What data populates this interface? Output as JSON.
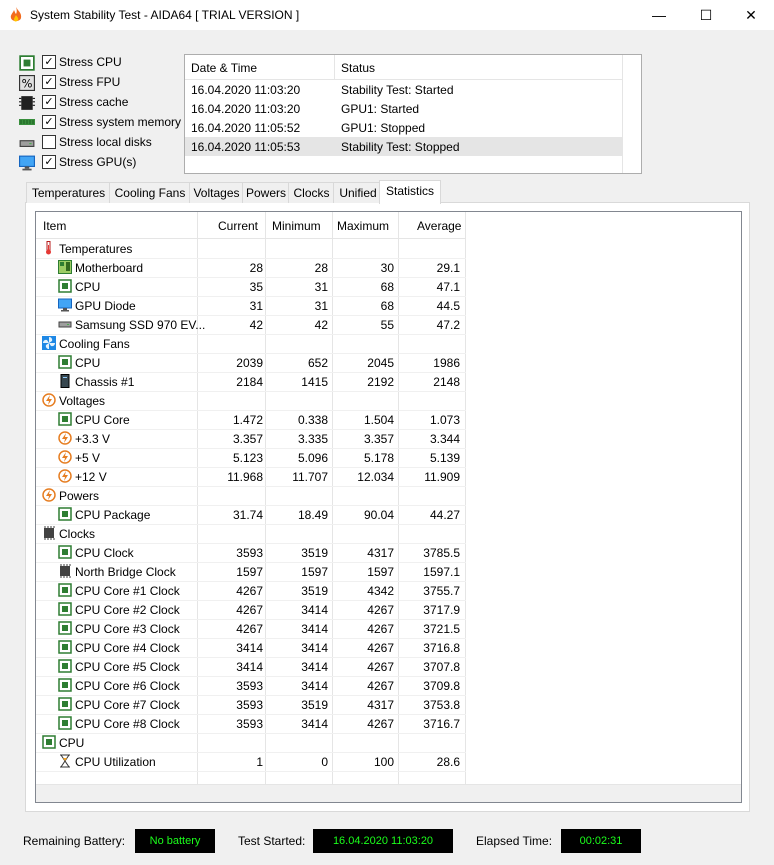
{
  "window": {
    "title": "System Stability Test - AIDA64  [ TRIAL VERSION ]",
    "min_glyph": "—",
    "max_glyph": "☐",
    "close_glyph": "✕"
  },
  "stress_options": [
    {
      "label": "Stress CPU",
      "checked": true,
      "icon": "cpu-chip-icon"
    },
    {
      "label": "Stress FPU",
      "checked": true,
      "icon": "fpu-icon"
    },
    {
      "label": "Stress cache",
      "checked": true,
      "icon": "cache-icon"
    },
    {
      "label": "Stress system memory",
      "checked": true,
      "icon": "memory-icon"
    },
    {
      "label": "Stress local disks",
      "checked": false,
      "icon": "disk-icon"
    },
    {
      "label": "Stress GPU(s)",
      "checked": true,
      "icon": "gpu-monitor-icon"
    }
  ],
  "log": {
    "col_datetime": "Date & Time",
    "col_status": "Status",
    "rows": [
      {
        "datetime": "16.04.2020 11:03:20",
        "status": "Stability Test: Started"
      },
      {
        "datetime": "16.04.2020 11:03:20",
        "status": "GPU1: Started"
      },
      {
        "datetime": "16.04.2020 11:05:52",
        "status": "GPU1: Stopped"
      },
      {
        "datetime": "16.04.2020 11:05:53",
        "status": "Stability Test: Stopped"
      }
    ]
  },
  "tabs": [
    "Temperatures",
    "Cooling Fans",
    "Voltages",
    "Powers",
    "Clocks",
    "Unified",
    "Statistics"
  ],
  "active_tab": "Statistics",
  "stats": {
    "col_item": "Item",
    "col_current": "Current",
    "col_minimum": "Minimum",
    "col_maximum": "Maximum",
    "col_average": "Average",
    "rows": [
      {
        "type": "group",
        "name": "Temperatures",
        "icon": "thermometer-icon"
      },
      {
        "type": "item",
        "name": "Motherboard",
        "icon": "motherboard-icon",
        "cur": "28",
        "min": "28",
        "max": "30",
        "avg": "29.1"
      },
      {
        "type": "item",
        "name": "CPU",
        "icon": "cpu-chip-icon",
        "cur": "35",
        "min": "31",
        "max": "68",
        "avg": "47.1"
      },
      {
        "type": "item",
        "name": "GPU Diode",
        "icon": "gpu-monitor-icon",
        "cur": "31",
        "min": "31",
        "max": "68",
        "avg": "44.5"
      },
      {
        "type": "item",
        "name": "Samsung SSD 970 EV...",
        "icon": "disk-icon",
        "cur": "42",
        "min": "42",
        "max": "55",
        "avg": "47.2"
      },
      {
        "type": "group",
        "name": "Cooling Fans",
        "icon": "fan-icon"
      },
      {
        "type": "item",
        "name": "CPU",
        "icon": "cpu-chip-icon",
        "cur": "2039",
        "min": "652",
        "max": "2045",
        "avg": "1986"
      },
      {
        "type": "item",
        "name": "Chassis #1",
        "icon": "chassis-icon",
        "cur": "2184",
        "min": "1415",
        "max": "2192",
        "avg": "2148"
      },
      {
        "type": "group",
        "name": "Voltages",
        "icon": "bolt-icon"
      },
      {
        "type": "item",
        "name": "CPU Core",
        "icon": "cpu-chip-icon",
        "cur": "1.472",
        "min": "0.338",
        "max": "1.504",
        "avg": "1.073"
      },
      {
        "type": "item",
        "name": "+3.3 V",
        "icon": "bolt-icon",
        "cur": "3.357",
        "min": "3.335",
        "max": "3.357",
        "avg": "3.344"
      },
      {
        "type": "item",
        "name": "+5 V",
        "icon": "bolt-icon",
        "cur": "5.123",
        "min": "5.096",
        "max": "5.178",
        "avg": "5.139"
      },
      {
        "type": "item",
        "name": "+12 V",
        "icon": "bolt-icon",
        "cur": "11.968",
        "min": "11.707",
        "max": "12.034",
        "avg": "11.909"
      },
      {
        "type": "group",
        "name": "Powers",
        "icon": "bolt-icon"
      },
      {
        "type": "item",
        "name": "CPU Package",
        "icon": "cpu-chip-icon",
        "cur": "31.74",
        "min": "18.49",
        "max": "90.04",
        "avg": "44.27"
      },
      {
        "type": "group",
        "name": "Clocks",
        "icon": "clock-chip-icon"
      },
      {
        "type": "item",
        "name": "CPU Clock",
        "icon": "cpu-chip-icon",
        "cur": "3593",
        "min": "3519",
        "max": "4317",
        "avg": "3785.5"
      },
      {
        "type": "item",
        "name": "North Bridge Clock",
        "icon": "clock-chip-icon",
        "cur": "1597",
        "min": "1597",
        "max": "1597",
        "avg": "1597.1"
      },
      {
        "type": "item",
        "name": "CPU Core #1 Clock",
        "icon": "cpu-chip-icon",
        "cur": "4267",
        "min": "3519",
        "max": "4342",
        "avg": "3755.7"
      },
      {
        "type": "item",
        "name": "CPU Core #2 Clock",
        "icon": "cpu-chip-icon",
        "cur": "4267",
        "min": "3414",
        "max": "4267",
        "avg": "3717.9"
      },
      {
        "type": "item",
        "name": "CPU Core #3 Clock",
        "icon": "cpu-chip-icon",
        "cur": "4267",
        "min": "3414",
        "max": "4267",
        "avg": "3721.5"
      },
      {
        "type": "item",
        "name": "CPU Core #4 Clock",
        "icon": "cpu-chip-icon",
        "cur": "3414",
        "min": "3414",
        "max": "4267",
        "avg": "3716.8"
      },
      {
        "type": "item",
        "name": "CPU Core #5 Clock",
        "icon": "cpu-chip-icon",
        "cur": "3414",
        "min": "3414",
        "max": "4267",
        "avg": "3707.8"
      },
      {
        "type": "item",
        "name": "CPU Core #6 Clock",
        "icon": "cpu-chip-icon",
        "cur": "3593",
        "min": "3414",
        "max": "4267",
        "avg": "3709.8"
      },
      {
        "type": "item",
        "name": "CPU Core #7 Clock",
        "icon": "cpu-chip-icon",
        "cur": "3593",
        "min": "3519",
        "max": "4317",
        "avg": "3753.8"
      },
      {
        "type": "item",
        "name": "CPU Core #8 Clock",
        "icon": "cpu-chip-icon",
        "cur": "3593",
        "min": "3414",
        "max": "4267",
        "avg": "3716.7"
      },
      {
        "type": "group",
        "name": "CPU",
        "icon": "cpu-chip-icon"
      },
      {
        "type": "item",
        "name": "CPU Utilization",
        "icon": "hourglass-icon",
        "cur": "1",
        "min": "0",
        "max": "100",
        "avg": "28.6"
      }
    ]
  },
  "status_bar": {
    "battery_label": "Remaining Battery:",
    "battery_value": "No battery",
    "started_label": "Test Started:",
    "started_value": "16.04.2020 11:03:20",
    "elapsed_label": "Elapsed Time:",
    "elapsed_value": "00:02:31"
  },
  "colors": {
    "accent_green": "#1bff1b",
    "chip_green": "#2e7d32",
    "bolt_orange": "#e67e22",
    "fan_blue": "#1e88e5"
  }
}
